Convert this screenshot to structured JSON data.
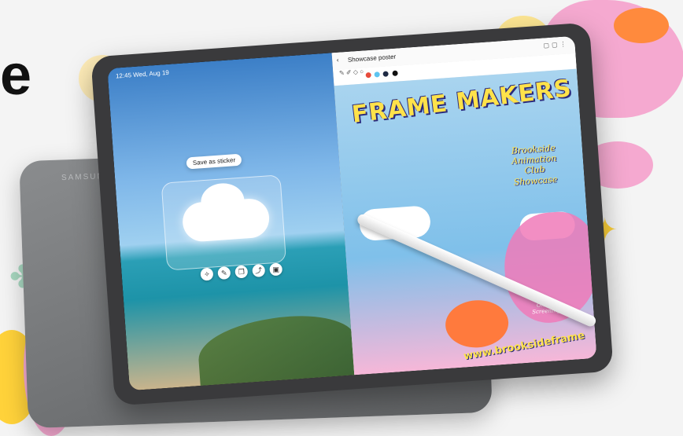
{
  "headline": {
    "text": "e"
  },
  "device": {
    "brand": "SAMSUNG"
  },
  "left_pane": {
    "status_time": "12:45  Wed, Aug 19",
    "sticker_button": "Save as sticker",
    "mini_toolbar_icons": [
      "wand-icon",
      "pen-icon",
      "copy-icon",
      "share-icon",
      "sticker-icon"
    ]
  },
  "right_pane": {
    "app_title": "Showcase poster",
    "poster": {
      "title": "FRAME MAKERS",
      "subtitle": "Brookside Animation Club Showcase",
      "badge": "Online Screening",
      "url": "www.brooksideframe"
    },
    "palette_colors": [
      "#e74c3c",
      "#5ec4f0",
      "#1f2a44",
      "#111111"
    ]
  },
  "colors": {
    "background": "#f4f4f4",
    "pink": "#f07ab8",
    "orange": "#ff7a3d",
    "yellow": "#ffd23a",
    "mint": "#9fd8b8",
    "lavender": "#d9c6ef"
  }
}
